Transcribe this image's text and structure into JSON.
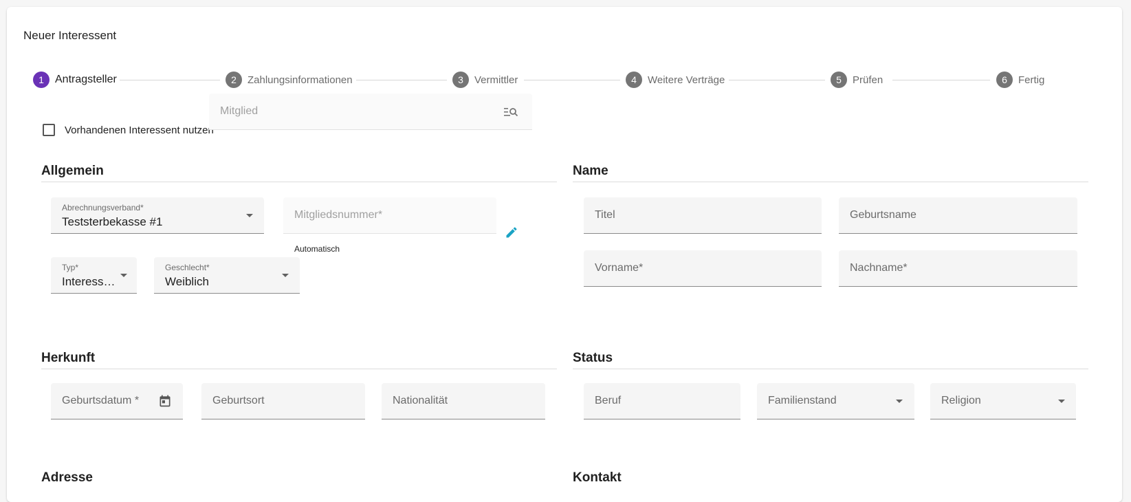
{
  "card": {
    "title": "Neuer Interessent"
  },
  "stepper": {
    "steps": [
      {
        "num": "1",
        "label": "Antragsteller"
      },
      {
        "num": "2",
        "label": "Zahlungsinformationen"
      },
      {
        "num": "3",
        "label": "Vermittler"
      },
      {
        "num": "4",
        "label": "Weitere Verträge"
      },
      {
        "num": "5",
        "label": "Prüfen"
      },
      {
        "num": "6",
        "label": "Fertig"
      }
    ],
    "active_color": "#6a32b6",
    "inactive_color": "#757575"
  },
  "existing": {
    "checkbox_label": "Vorhandenen Interessent nutzen",
    "member_placeholder": "Mitglied",
    "search_icon": "list-search-icon"
  },
  "sections": {
    "allgemein": {
      "title": "Allgemein",
      "abrechnungsverband": {
        "label": "Abrechnungsverband*",
        "value": "Teststerbekasse #1"
      },
      "mitgliedsnummer": {
        "placeholder": "Mitgliedsnummer*",
        "hint": "Automatisch",
        "edit_icon": "pencil-icon",
        "edit_color": "#1aa3c4"
      },
      "typ": {
        "label": "Typ*",
        "value": "Interessent"
      },
      "geschlecht": {
        "label": "Geschlecht*",
        "value": "Weiblich"
      }
    },
    "name": {
      "title": "Name",
      "titel": "Titel",
      "geburtsname": "Geburtsname",
      "vorname": "Vorname*",
      "nachname": "Nachname*"
    },
    "herkunft": {
      "title": "Herkunft",
      "geburtsdatum": "Geburtsdatum *",
      "calendar_icon": "calendar-icon",
      "geburtsort": "Geburtsort",
      "nationalitaet": "Nationalität"
    },
    "status": {
      "title": "Status",
      "beruf": "Beruf",
      "familienstand": "Familienstand",
      "religion": "Religion"
    },
    "adresse": {
      "title": "Adresse"
    },
    "kontakt": {
      "title": "Kontakt"
    }
  }
}
